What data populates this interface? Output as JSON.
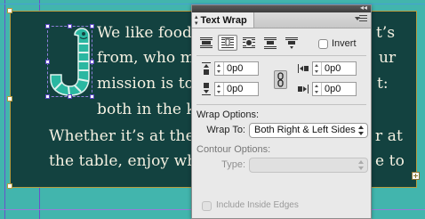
{
  "document": {
    "lines": [
      "We like food",
      "from, who m",
      "mission is to",
      "both in the k",
      "Whether it’s at the",
      "the table, enjoy wh"
    ],
    "right_fragments": [
      "t’s",
      "ur",
      "t:",
      "r at",
      "e to"
    ],
    "graphic": "worm-letter-j-graphic"
  },
  "panel": {
    "title": "Text Wrap",
    "collapse_label": "◂◂",
    "wrap_buttons": [
      {
        "name": "no-text-wrap-icon",
        "active": false
      },
      {
        "name": "wrap-around-bounding-box-icon",
        "active": true
      },
      {
        "name": "wrap-around-object-shape-icon",
        "active": false
      },
      {
        "name": "jump-object-icon",
        "active": false
      },
      {
        "name": "jump-to-next-column-icon",
        "active": false
      }
    ],
    "invert_label": "Invert",
    "invert_checked": false,
    "offsets": {
      "top": "0p0",
      "bottom": "0p0",
      "left": "0p0",
      "right": "0p0",
      "linked": true
    },
    "wrap_options_label": "Wrap Options:",
    "wrap_to_label": "Wrap To:",
    "wrap_to_value": "Both Right & Left Sides",
    "contour_options_label": "Contour Options:",
    "type_label": "Type:",
    "type_value": "",
    "include_inside_edges_label": "Include Inside Edges",
    "include_inside_edges_checked": false
  },
  "colors": {
    "page_background": "#42b5ad",
    "frame_fill": "#134240",
    "body_text": "#f5f1e2",
    "frame_border": "#b79b3e",
    "selection": "#6a52c9",
    "worm_green": "#2ab7a1"
  }
}
